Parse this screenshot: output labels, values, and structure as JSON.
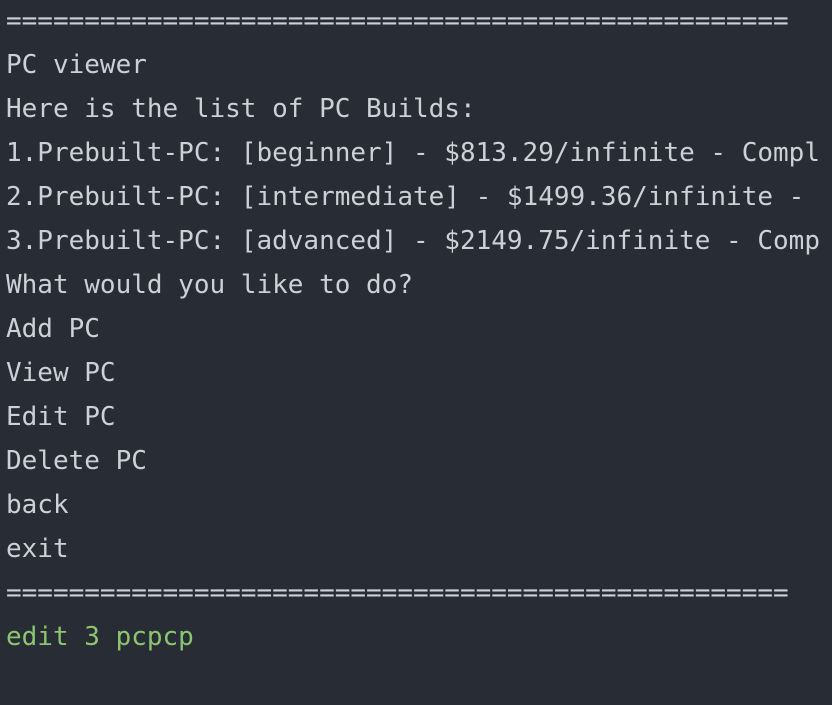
{
  "console": {
    "separator_top": "==================================================",
    "title": "PC viewer",
    "list_heading": "Here is the list of PC Builds:",
    "builds": [
      "1.Prebuilt-PC: [beginner] - $813.29/infinite - Compl",
      "2.Prebuilt-PC: [intermediate] - $1499.36/infinite - ",
      "3.Prebuilt-PC: [advanced] - $2149.75/infinite - Comp"
    ],
    "prompt": "What would you like to do?",
    "options": [
      "Add PC",
      "View PC",
      "Edit PC",
      "Delete PC",
      "back",
      "exit"
    ],
    "separator_bottom": "==================================================",
    "user_input": "edit 3 pcpcp"
  },
  "colors": {
    "background": "#282c34",
    "text": "#cdd0d6",
    "input_text": "#8cc570"
  }
}
